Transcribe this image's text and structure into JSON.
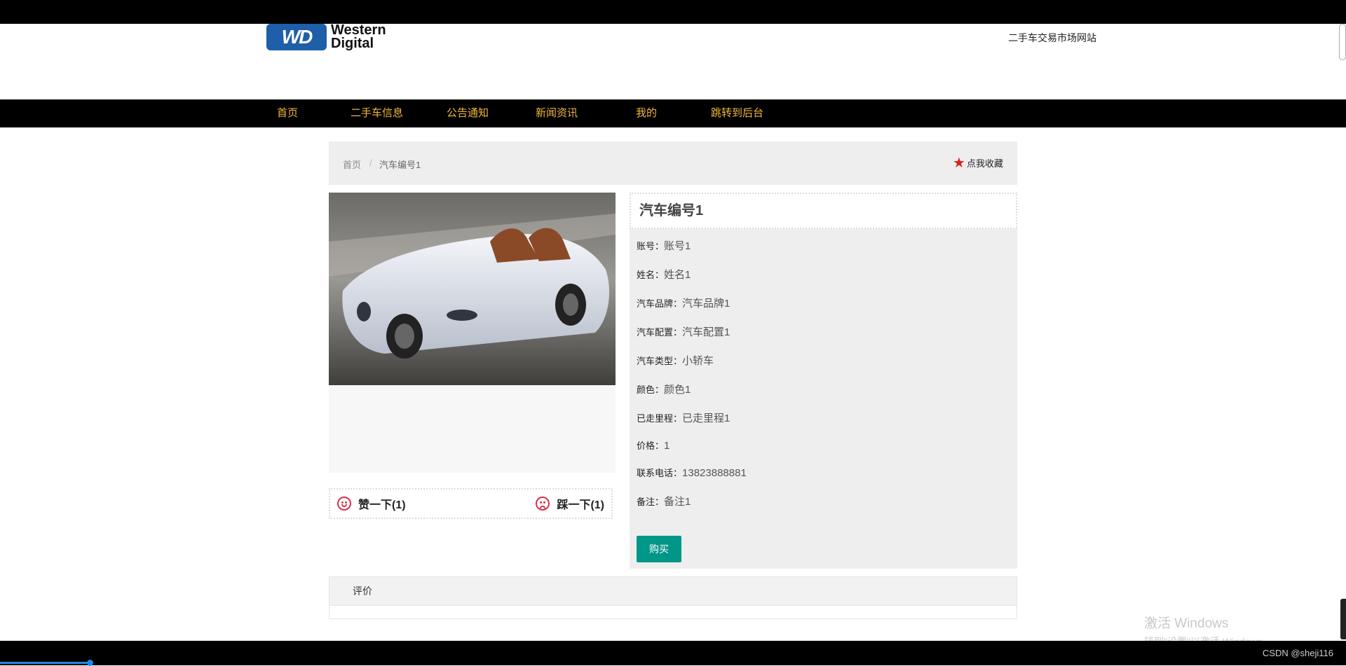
{
  "logo": {
    "badge": "WD",
    "line1": "Western",
    "line2": "Digital"
  },
  "site_name": "二手车交易市场网站",
  "nav": [
    "首页",
    "二手车信息",
    "公告通知",
    "新闻资讯",
    "我的",
    "跳转到后台"
  ],
  "breadcrumb": {
    "home": "首页",
    "separator": "/",
    "current": "汽车编号1"
  },
  "favorite_label": "点我收藏",
  "likes": {
    "like_label": "赞一下(1)",
    "dislike_label": "踩一下(1)"
  },
  "detail": {
    "title": "汽车编号1",
    "fields": [
      {
        "label": "账号：",
        "value": "账号1"
      },
      {
        "label": "姓名：",
        "value": "姓名1"
      },
      {
        "label": "汽车品牌：",
        "value": "汽车品牌1"
      },
      {
        "label": "汽车配置：",
        "value": "汽车配置1"
      },
      {
        "label": "汽车类型：",
        "value": "小轿车"
      },
      {
        "label": "颜色：",
        "value": "颜色1"
      },
      {
        "label": "已走里程：",
        "value": "已走里程1"
      },
      {
        "label": "价格：",
        "value": "1"
      },
      {
        "label": "联系电话：",
        "value": "13823888881"
      },
      {
        "label": "备注：",
        "value": "备注1"
      }
    ],
    "buy_label": "购买"
  },
  "review_title": "评价",
  "watermark": {
    "line1": "激活 Windows",
    "line2": "转到\"设置\"以激活 Windows。"
  },
  "footer_credit": "CSDN @sheji116",
  "colors": {
    "nav_text": "#f2b73a",
    "buy_button": "#009688",
    "star": "#e31b1b",
    "face": "#d7334c"
  }
}
